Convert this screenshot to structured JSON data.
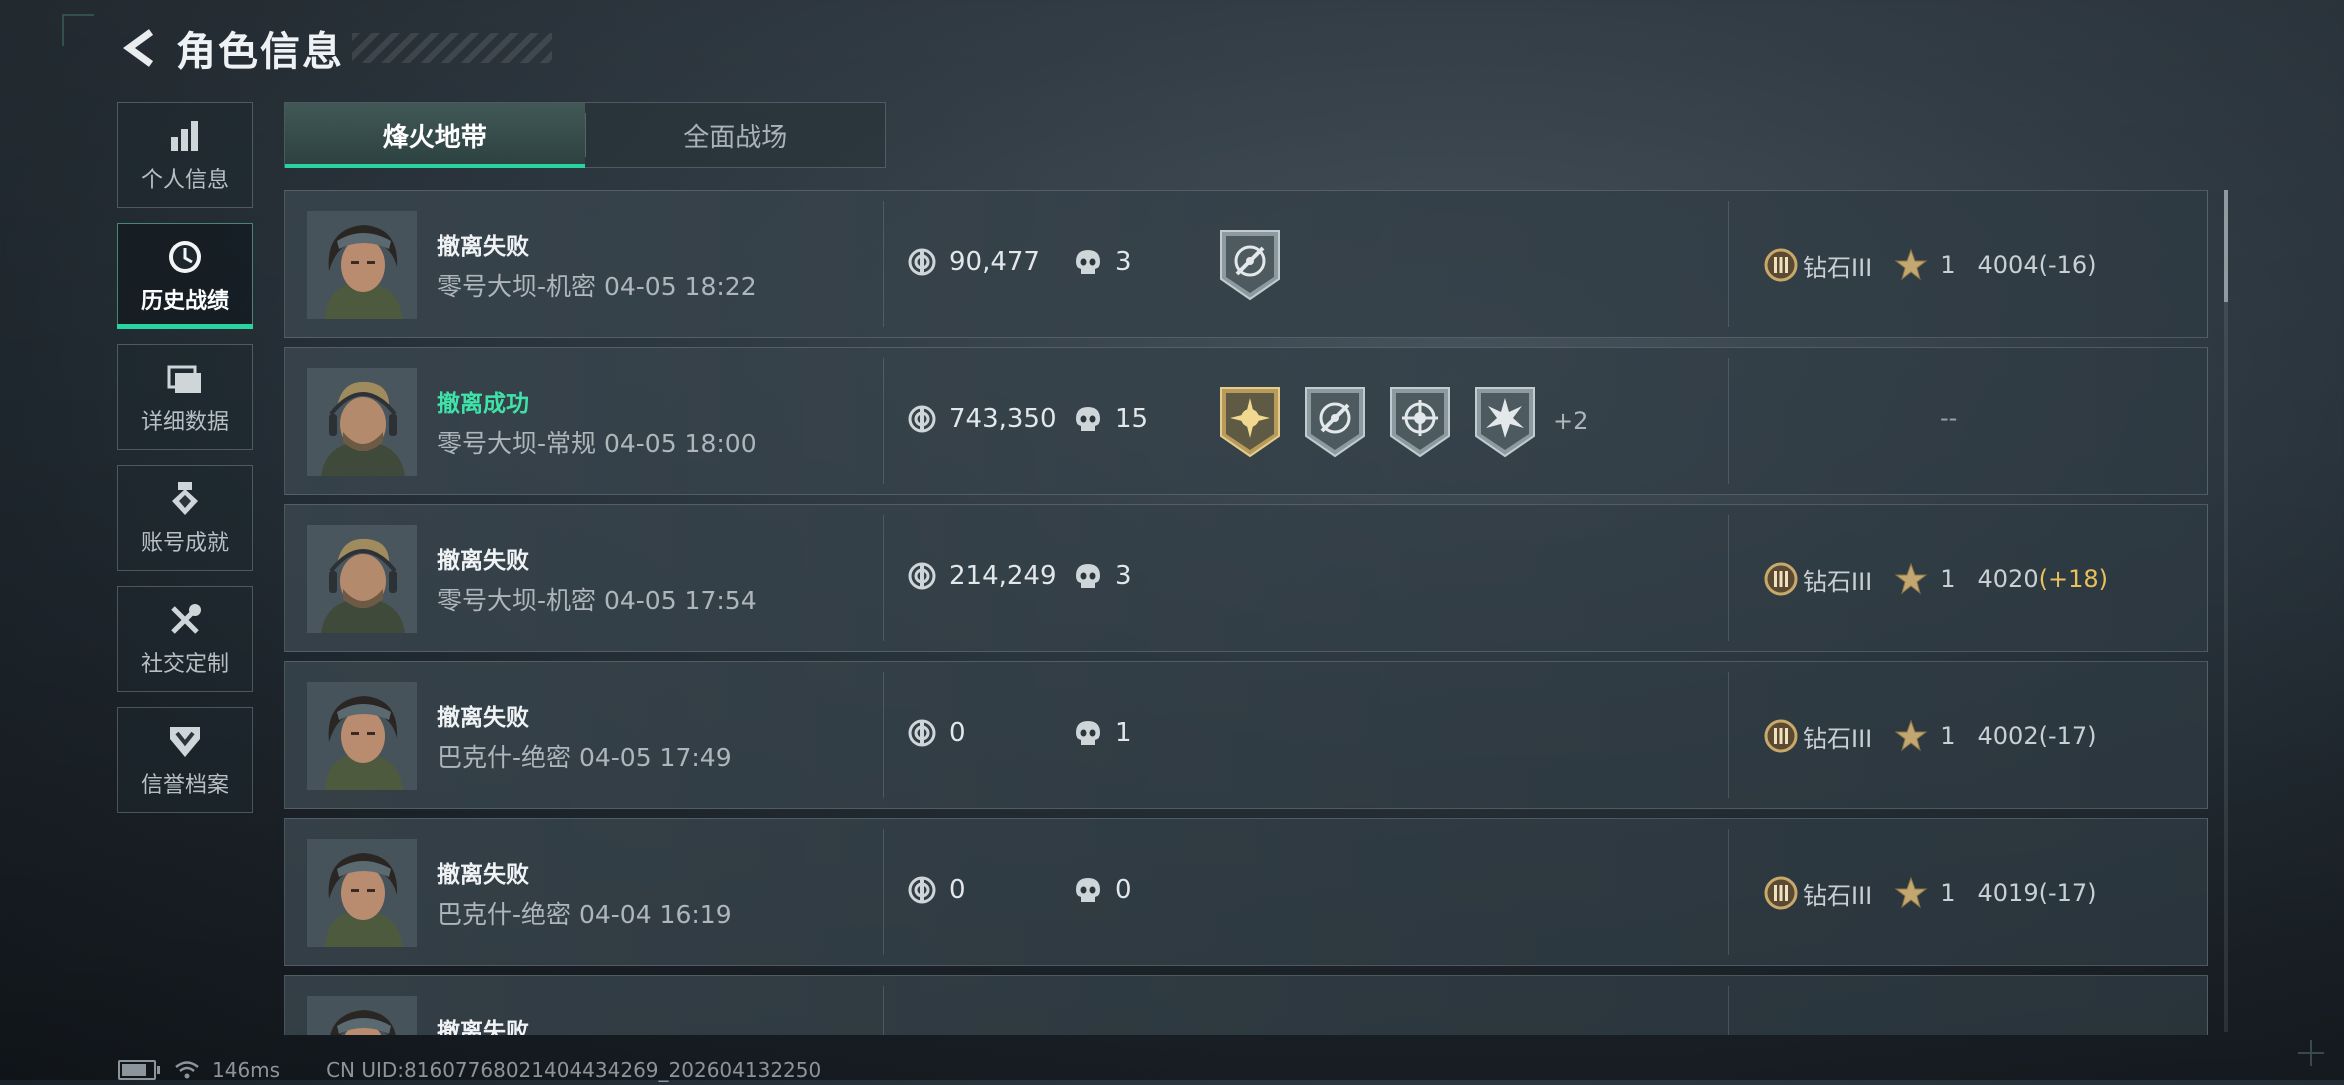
{
  "header": {
    "title": "角色信息"
  },
  "sidebar": {
    "items": [
      {
        "label": "个人信息",
        "icon": "bar-chart-icon",
        "active": false
      },
      {
        "label": "历史战绩",
        "icon": "clock-icon",
        "active": true
      },
      {
        "label": "详细数据",
        "icon": "folder-icon",
        "active": false
      },
      {
        "label": "账号成就",
        "icon": "achievement-medal-icon",
        "active": false
      },
      {
        "label": "社交定制",
        "icon": "tools-icon",
        "active": false
      },
      {
        "label": "信誉档案",
        "icon": "shield-chevron-icon",
        "active": false
      }
    ]
  },
  "tabs": [
    {
      "label": "烽火地带",
      "active": true
    },
    {
      "label": "全面战场",
      "active": false
    }
  ],
  "records": [
    {
      "status": "撤离失败",
      "success": false,
      "map": "零号大坝-机密 04-05 18:22",
      "avatar": "female-operator",
      "value": "90,477",
      "kills": "3",
      "medals": [
        "silver-target-medal"
      ],
      "more": "",
      "rank": "钻石III",
      "stars": "1",
      "score": "4004",
      "delta": "(-16)",
      "delta_positive": false
    },
    {
      "status": "撤离成功",
      "success": true,
      "map": "零号大坝-常规 04-05 18:00",
      "avatar": "male-operator",
      "value": "743,350",
      "kills": "15",
      "medals": [
        "gold-sun-medal",
        "silver-target-medal",
        "silver-crosshair-medal",
        "silver-burst-medal"
      ],
      "more": "+2",
      "rank": "",
      "stars": "",
      "score": "",
      "delta": "",
      "delta_positive": false,
      "empty_rank": "--"
    },
    {
      "status": "撤离失败",
      "success": false,
      "map": "零号大坝-机密 04-05 17:54",
      "avatar": "male-operator",
      "value": "214,249",
      "kills": "3",
      "medals": [],
      "more": "",
      "rank": "钻石III",
      "stars": "1",
      "score": "4020",
      "delta": "(+18)",
      "delta_positive": true
    },
    {
      "status": "撤离失败",
      "success": false,
      "map": "巴克什-绝密 04-05 17:49",
      "avatar": "female-operator",
      "value": "0",
      "kills": "1",
      "medals": [],
      "more": "",
      "rank": "钻石III",
      "stars": "1",
      "score": "4002",
      "delta": "(-17)",
      "delta_positive": false
    },
    {
      "status": "撤离失败",
      "success": false,
      "map": "巴克什-绝密 04-04 16:19",
      "avatar": "female-operator",
      "value": "0",
      "kills": "0",
      "medals": [],
      "more": "",
      "rank": "钻石III",
      "stars": "1",
      "score": "4019",
      "delta": "(-17)",
      "delta_positive": false
    },
    {
      "status": "撤离失败",
      "success": false,
      "map": "",
      "avatar": "female-operator",
      "value": "",
      "kills": "",
      "medals": [],
      "more": "",
      "rank": "",
      "stars": "",
      "score": "",
      "delta": "",
      "delta_positive": false
    }
  ],
  "footer": {
    "ping": "146ms",
    "uid": "CN UID:8160776802140443426​9_202604132250"
  },
  "colors": {
    "accent": "#2ad4a0",
    "success": "#3fe3a8",
    "gain": "#e8c15a"
  }
}
